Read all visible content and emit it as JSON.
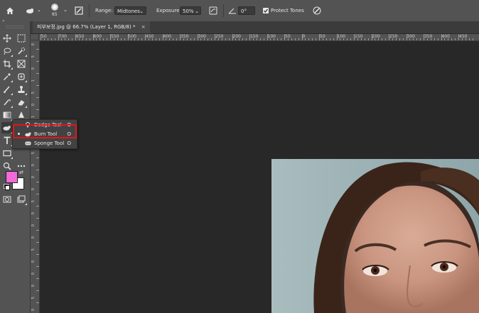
{
  "options_bar": {
    "brush_size": "65",
    "range_label": "Range:",
    "range_value": "Midtones",
    "exposure_label": "Exposure:",
    "exposure_value": "50%",
    "angle_value": "0°",
    "protect_tones_label": "Protect Tones"
  },
  "document_tab": {
    "title": "피부보정.jpg @ 66.7% (Layer 1, RGB/8) *",
    "close": "×"
  },
  "ruler": {
    "top_labels": [
      "50",
      "700",
      "650",
      "600",
      "550",
      "500",
      "450",
      "400",
      "350",
      "300",
      "250",
      "200",
      "150",
      "100",
      "50",
      "0",
      "50",
      "100",
      "150",
      "200",
      "250",
      "300",
      "350",
      "400",
      "450"
    ],
    "left_labels": [
      "0",
      "5",
      "0",
      "1",
      "5",
      "0",
      "1",
      "0",
      "0",
      "5",
      "0",
      "0",
      "0",
      "5",
      "0",
      "0",
      "0",
      "5",
      "0",
      "0",
      "0",
      "5",
      "0"
    ]
  },
  "flyout": {
    "items": [
      {
        "label": "Dodge Tool",
        "shortcut": "O",
        "active": false
      },
      {
        "label": "Burn Tool",
        "shortcut": "O",
        "active": true
      },
      {
        "label": "Sponge Tool",
        "shortcut": "O",
        "active": false
      }
    ]
  },
  "colors": {
    "foreground": "#f06ad8",
    "background": "#ffffff",
    "highlight": "#e0151b"
  }
}
